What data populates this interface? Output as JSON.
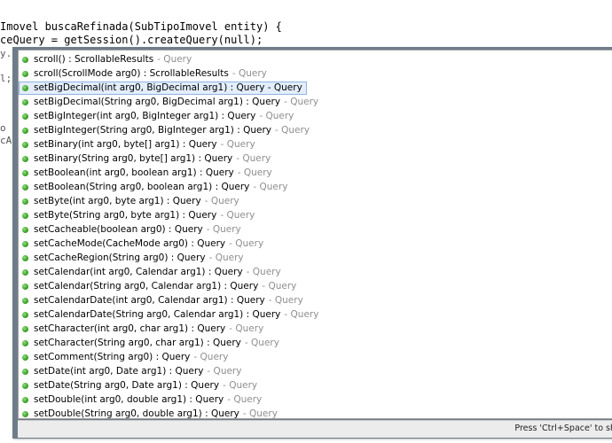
{
  "editor": {
    "line1": "Imovel buscaRefinada(SubTipoImovel entity) {",
    "line2": "ceQuery = getSession().createQuery(null);",
    "frag3": "y.",
    "frag4": "l;",
    "frag5": "o",
    "frag6": "cA"
  },
  "popup": {
    "items": [
      {
        "sig": "scroll() : ScrollableResults",
        "decl": "- Query"
      },
      {
        "sig": "scroll(ScrollMode arg0) : ScrollableResults",
        "decl": "- Query"
      },
      {
        "sig": "setBigDecimal(int arg0, BigDecimal arg1) : Query - Query",
        "decl": ""
      },
      {
        "sig": "setBigDecimal(String arg0, BigDecimal arg1) : Query",
        "decl": "- Query"
      },
      {
        "sig": "setBigInteger(int arg0, BigInteger arg1) : Query",
        "decl": "- Query"
      },
      {
        "sig": "setBigInteger(String arg0, BigInteger arg1) : Query",
        "decl": "- Query"
      },
      {
        "sig": "setBinary(int arg0, byte[] arg1) : Query",
        "decl": "- Query"
      },
      {
        "sig": "setBinary(String arg0, byte[] arg1) : Query",
        "decl": "- Query"
      },
      {
        "sig": "setBoolean(int arg0, boolean arg1) : Query",
        "decl": "- Query"
      },
      {
        "sig": "setBoolean(String arg0, boolean arg1) : Query",
        "decl": "- Query"
      },
      {
        "sig": "setByte(int arg0, byte arg1) : Query",
        "decl": "- Query"
      },
      {
        "sig": "setByte(String arg0, byte arg1) : Query",
        "decl": "- Query"
      },
      {
        "sig": "setCacheable(boolean arg0) : Query",
        "decl": "- Query"
      },
      {
        "sig": "setCacheMode(CacheMode arg0) : Query",
        "decl": "- Query"
      },
      {
        "sig": "setCacheRegion(String arg0) : Query",
        "decl": "- Query"
      },
      {
        "sig": "setCalendar(int arg0, Calendar arg1) : Query",
        "decl": "- Query"
      },
      {
        "sig": "setCalendar(String arg0, Calendar arg1) : Query",
        "decl": "- Query"
      },
      {
        "sig": "setCalendarDate(int arg0, Calendar arg1) : Query",
        "decl": "- Query"
      },
      {
        "sig": "setCalendarDate(String arg0, Calendar arg1) : Query",
        "decl": "- Query"
      },
      {
        "sig": "setCharacter(int arg0, char arg1) : Query",
        "decl": "- Query"
      },
      {
        "sig": "setCharacter(String arg0, char arg1) : Query",
        "decl": "- Query"
      },
      {
        "sig": "setComment(String arg0) : Query",
        "decl": "- Query"
      },
      {
        "sig": "setDate(int arg0, Date arg1) : Query",
        "decl": "- Query"
      },
      {
        "sig": "setDate(String arg0, Date arg1) : Query",
        "decl": "- Query"
      },
      {
        "sig": "setDouble(int arg0, double arg1) : Query",
        "decl": "- Query"
      },
      {
        "sig": "setDouble(String arg0, double arg1) : Query",
        "decl": "- Query"
      }
    ],
    "selected_index": 2,
    "status": "Press 'Ctrl+Space' to sh",
    "colors": {
      "frame": "#6e7c8a",
      "selection_bg": "#e3eefc",
      "selection_border": "#8fb3e3",
      "method_icon": "#3da02a",
      "declaring_type": "#8e8e8e"
    }
  }
}
